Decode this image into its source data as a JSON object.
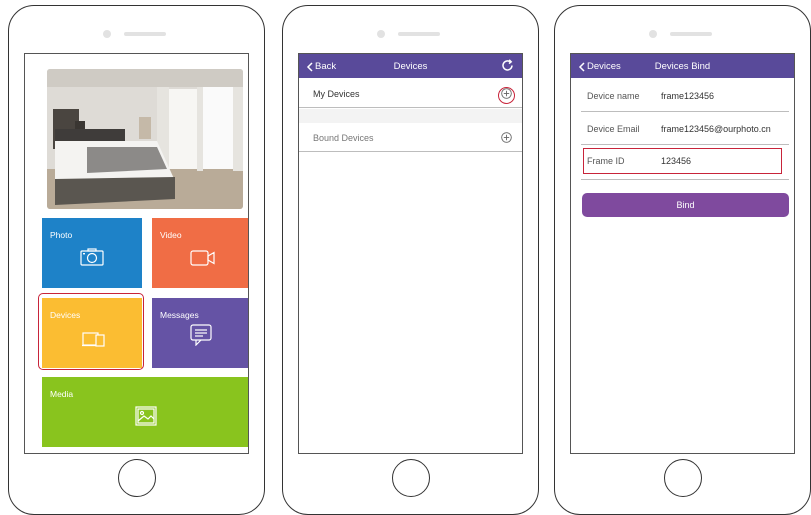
{
  "phone1": {
    "tiles": {
      "photo": "Photo",
      "video": "Video",
      "devices": "Devices",
      "messages": "Messages",
      "media": "Media"
    }
  },
  "phone2": {
    "header": {
      "back": "Back",
      "title": "Devices"
    },
    "rows": {
      "my_devices": "My Devices",
      "bound_devices": "Bound Devices"
    }
  },
  "phone3": {
    "header": {
      "back": "Devices",
      "title": "Devices Bind"
    },
    "fields": {
      "device_name_label": "Device name",
      "device_name_value": "frame123456",
      "device_email_label": "Device Email",
      "device_email_value": "frame123456@ourphoto.cn",
      "frame_id_label": "Frame ID",
      "frame_id_value": "123456"
    },
    "bind_label": "Bind"
  },
  "colors": {
    "header_purple": "#594a9a",
    "photo_blue": "#1e82c8",
    "video_orange": "#f06d45",
    "devices_yellow": "#fbbd32",
    "messages_purple": "#6553a5",
    "media_green": "#89c41e",
    "bind_purple": "#7f4a9e",
    "highlight_red": "#c8243a"
  }
}
